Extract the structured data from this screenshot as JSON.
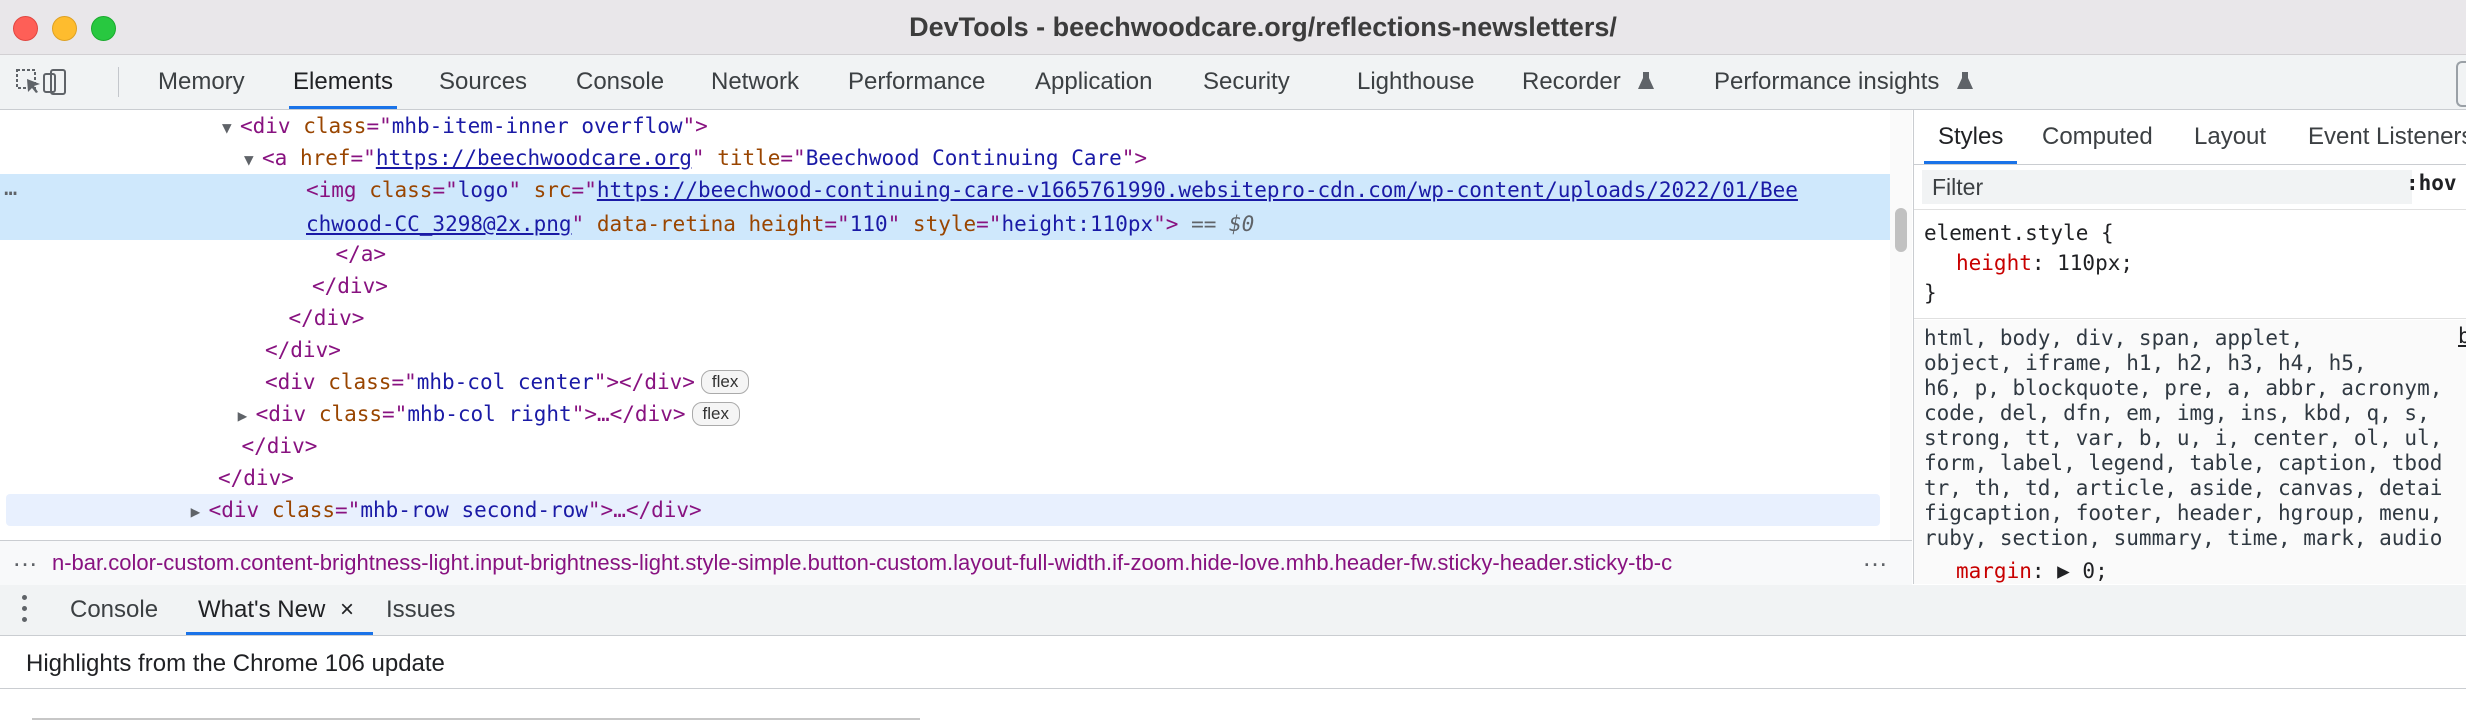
{
  "window": {
    "title": "DevTools - beechwoodcare.org/reflections-newsletters/"
  },
  "toolbar": {
    "icons": [
      "inspect-element-icon",
      "device-toolbar-icon"
    ],
    "tabs": [
      "Memory",
      "Elements",
      "Sources",
      "Console",
      "Network",
      "Performance",
      "Application",
      "Security",
      "Lighthouse",
      "Recorder",
      "Performance insights"
    ],
    "active_tab": "Elements"
  },
  "elements": {
    "lines": [
      {
        "indent": 1,
        "arrow": "▼",
        "parts": [
          [
            "tag",
            "<div "
          ],
          [
            "attr",
            "class"
          ],
          [
            "tag",
            "=\""
          ],
          [
            "val",
            "mhb-item-inner overflow"
          ],
          [
            "tag",
            "\">"
          ]
        ]
      },
      {
        "indent": 2,
        "arrow": "▼",
        "parts": [
          [
            "tag",
            "<a "
          ],
          [
            "attr",
            "href"
          ],
          [
            "tag",
            "=\""
          ],
          [
            "link",
            "https://beechwoodcare.org"
          ],
          [
            "tag",
            "\" "
          ],
          [
            "attr",
            "title"
          ],
          [
            "tag",
            "=\""
          ],
          [
            "val",
            "Beechwood Continuing Care"
          ],
          [
            "tag",
            "\">"
          ]
        ]
      },
      {
        "indent": 3,
        "arrow": "",
        "parts": [
          [
            "tag",
            "<img "
          ],
          [
            "attr",
            "class"
          ],
          [
            "tag",
            "=\""
          ],
          [
            "val",
            "logo"
          ],
          [
            "tag",
            "\" "
          ],
          [
            "attr",
            "src"
          ],
          [
            "tag",
            "=\""
          ],
          [
            "link",
            "https://beechwood-continuing-care-v1665761990.websitepro-cdn.com/wp-content/uploads/2022/01/Bee"
          ]
        ]
      },
      {
        "indent": 3,
        "arrow": "",
        "parts": [
          [
            "link",
            "chwood-CC_3298@2x.png"
          ],
          [
            "tag",
            "\" "
          ],
          [
            "attr",
            "data-retina "
          ],
          [
            "attr",
            "height"
          ],
          [
            "tag",
            "=\""
          ],
          [
            "val",
            "110"
          ],
          [
            "tag",
            "\" "
          ],
          [
            "attr",
            "style"
          ],
          [
            "tag",
            "=\""
          ],
          [
            "val",
            "height:110px"
          ],
          [
            "tag",
            "\">"
          ],
          [
            "eq0",
            " == $0"
          ]
        ]
      },
      {
        "indent": 2.5,
        "arrow": "",
        "parts": [
          [
            "tag",
            "</a>"
          ]
        ]
      },
      {
        "indent": 2,
        "arrow": "",
        "parts": [
          [
            "tag",
            "</div>"
          ]
        ]
      },
      {
        "indent": 1.5,
        "arrow": "",
        "parts": [
          [
            "tag",
            "</div>"
          ]
        ]
      },
      {
        "indent": 1,
        "arrow": "",
        "parts": [
          [
            "tag",
            "</div>"
          ]
        ]
      },
      {
        "indent": 1,
        "arrow": "",
        "parts": [
          [
            "tag",
            "<div "
          ],
          [
            "attr",
            "class"
          ],
          [
            "tag",
            "=\""
          ],
          [
            "val",
            "mhb-col center"
          ],
          [
            "tag",
            "\"></div>"
          ]
        ],
        "badge": "flex"
      },
      {
        "indent": 0.8,
        "arrow": "▶",
        "parts": [
          [
            "tag",
            "<div "
          ],
          [
            "attr",
            "class"
          ],
          [
            "tag",
            "=\""
          ],
          [
            "val",
            "mhb-col right"
          ],
          [
            "tag",
            "\">…</div>"
          ]
        ],
        "badge": "flex"
      },
      {
        "indent": 0.5,
        "arrow": "",
        "parts": [
          [
            "tag",
            "</div>"
          ]
        ]
      },
      {
        "indent": 0,
        "arrow": "",
        "parts": [
          [
            "tag",
            "</div>"
          ]
        ]
      },
      {
        "indent": -0.2,
        "arrow": "▶",
        "parts": [
          [
            "tag",
            "<div "
          ],
          [
            "attr",
            "class"
          ],
          [
            "tag",
            "=\""
          ],
          [
            "val",
            "mhb-row second-row"
          ],
          [
            "tag",
            "\">…</div>"
          ]
        ]
      }
    ],
    "more_dots": "…"
  },
  "breadcrumb": {
    "text": "n-bar.color-custom.content-brightness-light.input-brightness-light.style-simple.button-custom.layout-full-width.if-zoom.hide-love.mhb.header-fw.sticky-header.sticky-tb-c",
    "dots_left": "…",
    "dots_right": "…"
  },
  "styles": {
    "tabs": [
      "Styles",
      "Computed",
      "Layout",
      "Event Listeners"
    ],
    "active_tab": "Styles",
    "filter_placeholder": "Filter",
    "hov": ":hov",
    "element_style": {
      "selector": "element.style {",
      "prop": "height",
      "value": ": 110px;",
      "close": "}"
    },
    "ua_selector": "html, body, div, span, applet,\nobject, iframe, h1, h2, h3, h4, h5,\nh6, p, blockquote, pre, a, abbr, acronym,\ncode, del, dfn, em, img, ins, kbd, q, s,\nstrong, tt, var, b, u, i, center, ol, ul,\nform, label, legend, table, caption, tbod\ntr, th, td, article, aside, canvas, detai\nfigcaption, footer, header, hgroup, menu,\nruby, section, summary, time, mark, audio",
    "ua_link": "b",
    "margin": {
      "prop": "margin",
      "value": ": ▶ 0;"
    }
  },
  "drawer": {
    "tabs": [
      "Console",
      "What's New",
      "Issues"
    ],
    "active_tab": "What's New",
    "close": "×",
    "highlight": "Highlights from the Chrome 106 update"
  }
}
